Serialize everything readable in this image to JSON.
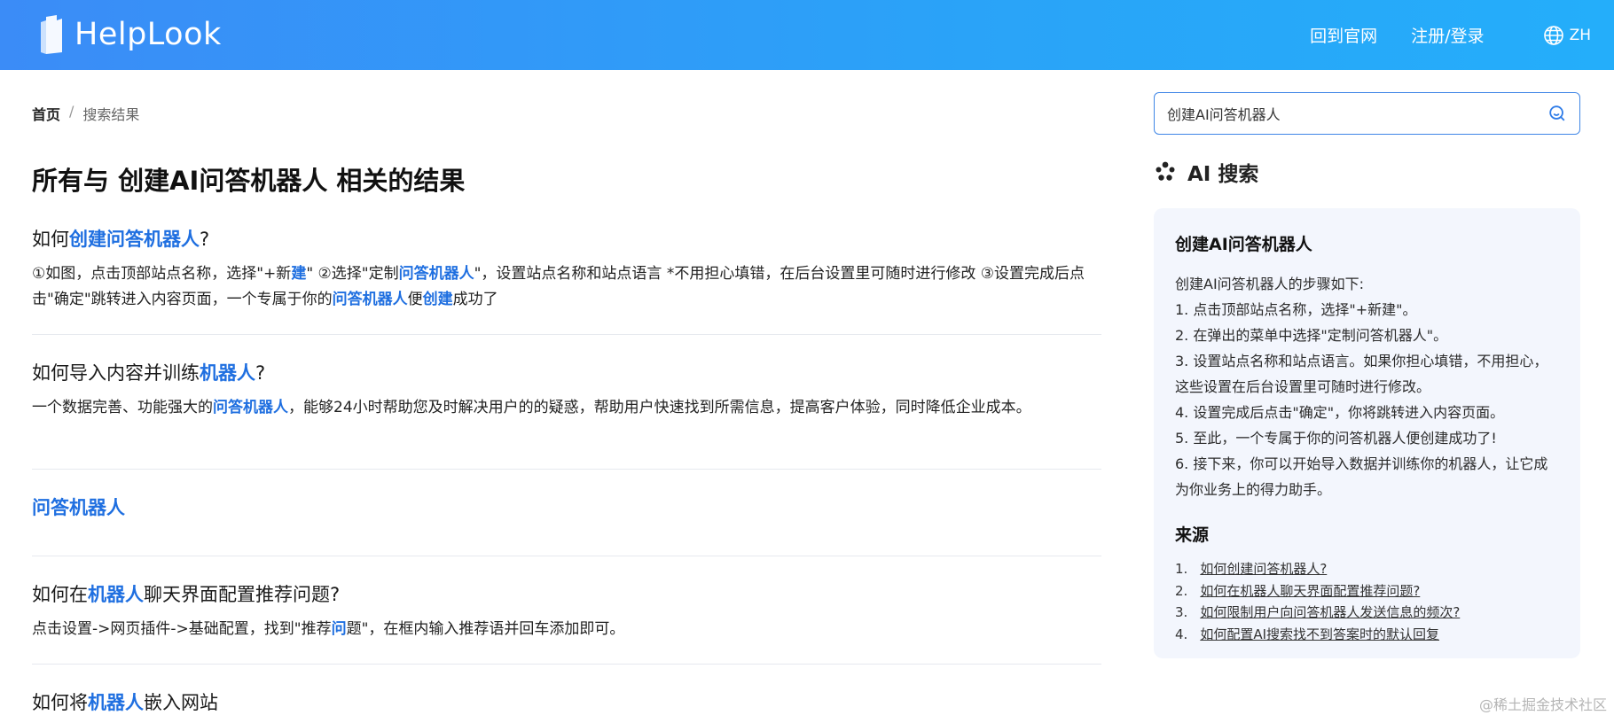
{
  "header": {
    "brand": "HelpLook",
    "nav_home": "回到官网",
    "nav_login": "注册/登录",
    "lang": "ZH"
  },
  "breadcrumb": {
    "home": "首页",
    "sep": "/",
    "current": "搜索结果"
  },
  "page_title": "所有与 创建AI问答机器人 相关的结果",
  "results": [
    {
      "title": [
        [
          "如何",
          false
        ],
        [
          "创建问答机器人",
          true
        ],
        [
          "?",
          false
        ]
      ],
      "body": [
        [
          "①如图，点击顶部站点名称，选择\"+新",
          false
        ],
        [
          "建",
          true
        ],
        [
          "\" ②选择\"定制",
          false
        ],
        [
          "问答机器人",
          true
        ],
        [
          "\"，设置站点名称和站点语言 *不用担心填错，在后台设置里可随时进行修改 ③设置完成后点击\"确定\"跳转进入内容页面，一个专属于你的",
          false
        ],
        [
          "问答机器人",
          true
        ],
        [
          "便",
          false
        ],
        [
          "创建",
          true
        ],
        [
          "成功了",
          false
        ]
      ]
    },
    {
      "title": [
        [
          "如何导入内容并训练",
          false
        ],
        [
          "机器人",
          true
        ],
        [
          "?",
          false
        ]
      ],
      "body": [
        [
          "一个数据完善、功能强大的",
          false
        ],
        [
          "问答机器人",
          true
        ],
        [
          "，能够24小时帮助您及时解决用户的的疑惑，帮助用户快速找到所需信息，提高客户体验，同时降低企业成本。",
          false
        ]
      ]
    },
    {
      "title": [
        [
          "问答机器人",
          true
        ]
      ],
      "body": []
    },
    {
      "title": [
        [
          "如何在",
          false
        ],
        [
          "机器人",
          true
        ],
        [
          "聊天界面配置推荐问题?",
          false
        ]
      ],
      "body": [
        [
          "点击设置->网页插件->基础配置，找到\"推荐",
          false
        ],
        [
          "问",
          true
        ],
        [
          "题\"，在框内输入推荐语并回车添加即可。",
          false
        ]
      ]
    },
    {
      "title": [
        [
          "如何将",
          false
        ],
        [
          "机器人",
          true
        ],
        [
          "嵌入网站",
          false
        ]
      ],
      "body": []
    }
  ],
  "search": {
    "value": "创建AI问答机器人"
  },
  "ai": {
    "heading": "AI 搜索",
    "card_title": "创建AI问答机器人",
    "answer": [
      "创建AI问答机器人的步骤如下:",
      "1. 点击顶部站点名称，选择\"+新建\"。",
      "2. 在弹出的菜单中选择\"定制问答机器人\"。",
      "3. 设置站点名称和站点语言。如果你担心填错，不用担心，这些设置在后台设置里可随时进行修改。",
      "4. 设置完成后点击\"确定\"，你将跳转进入内容页面。",
      "5. 至此，一个专属于你的问答机器人便创建成功了!",
      "6. 接下来，你可以开始导入数据并训练你的机器人，让它成为你业务上的得力助手。"
    ],
    "source_title": "来源",
    "sources": [
      {
        "num": "1.",
        "label": "如何创建问答机器人?"
      },
      {
        "num": "2.",
        "label": "如何在机器人聊天界面配置推荐问题?"
      },
      {
        "num": "3.",
        "label": "如何限制用户向问答机器人发送信息的频次?"
      },
      {
        "num": "4.",
        "label": "如何配置AI搜索找不到答案时的默认回复"
      }
    ]
  },
  "watermark": "@稀土掘金技术社区"
}
